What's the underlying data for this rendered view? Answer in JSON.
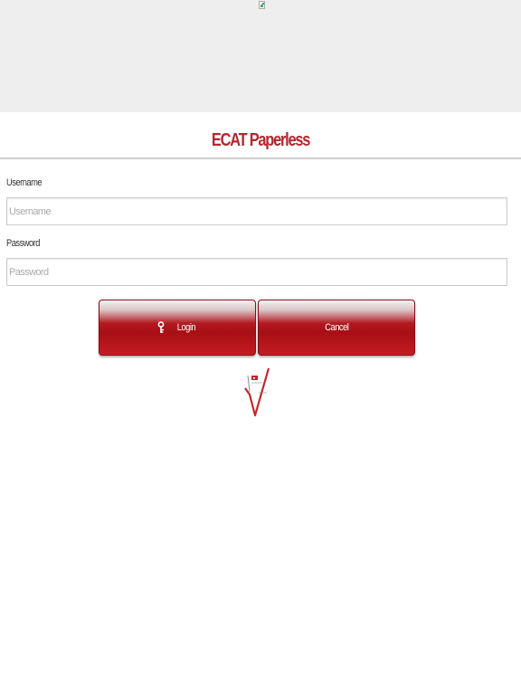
{
  "header": {
    "title": "ECAT Paperless"
  },
  "form": {
    "username": {
      "label": "Username",
      "placeholder": "Username",
      "value": ""
    },
    "password": {
      "label": "Password",
      "placeholder": "Password",
      "value": ""
    }
  },
  "buttons": {
    "login_label": "Login",
    "login_icon": "key-icon",
    "cancel_label": "Cancel"
  },
  "colors": {
    "brand_red": "#b0292f",
    "button_red": "#a80f15",
    "banner_gray": "#eeeeee"
  },
  "icons": {
    "top_image": "broken-image-icon",
    "logo": "checkmark-logo"
  }
}
